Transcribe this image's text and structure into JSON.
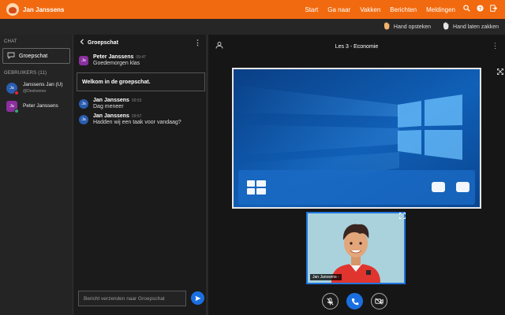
{
  "header": {
    "user_name": "Jan Janssens",
    "nav": [
      "Start",
      "Ga naar",
      "Vakken",
      "Berichten",
      "Meldingen"
    ],
    "icons": [
      "search-icon",
      "help-icon",
      "logout-icon"
    ],
    "accent": "#f26a0f"
  },
  "hand_bar": {
    "raise_label": "Hand opsteken",
    "lower_label": "Hand laten zakken"
  },
  "sidebar": {
    "chat_heading": "CHAT",
    "chat_item": "Groepschat",
    "users_heading": "GEBRUIKERS (11)",
    "users": [
      {
        "initials": "Ja",
        "name": "Janssens Jan (U)",
        "role": "@Deelnemer"
      },
      {
        "initials": "Ja",
        "name": "Peter Janssens"
      }
    ]
  },
  "chat": {
    "title": "Groepschat",
    "messages": [
      {
        "initials": "Ja",
        "name": "Peter Janssens",
        "time": "09:47",
        "text": "Goedemorgen klas"
      },
      {
        "initials": "Ja",
        "name": "Jan Janssens",
        "time": "09:53",
        "text": "Dag meneer"
      },
      {
        "initials": "Ja",
        "name": "Jan Janssens",
        "time": "09:57",
        "text": "Hadden wij een taak voor vandaag?"
      }
    ],
    "welcome": "Welkom in de groepschat.",
    "composer_placeholder": "Bericht verzenden naar Groepschat"
  },
  "meeting": {
    "title": "Les 3 - Economie",
    "webcam_label": "Jan Janssens -",
    "controls": [
      "mute-icon",
      "phone-icon",
      "camera-off-icon"
    ]
  }
}
